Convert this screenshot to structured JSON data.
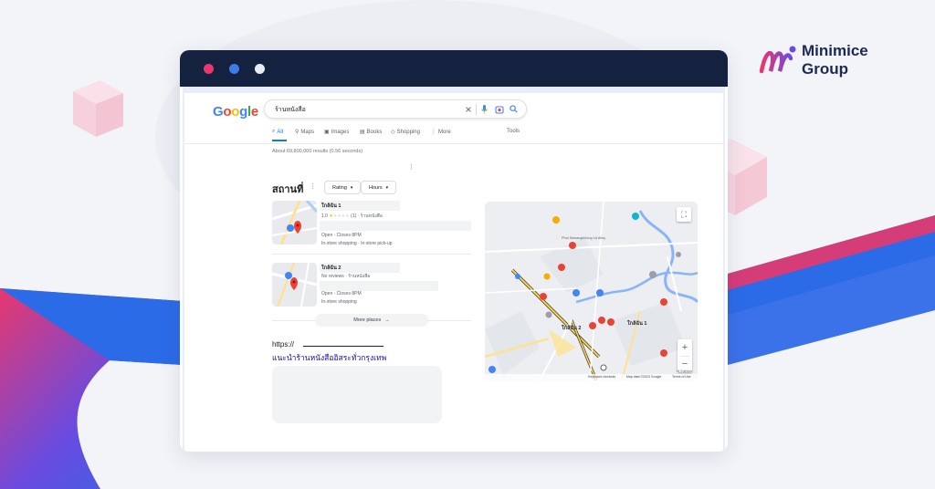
{
  "brand": {
    "name_line1": "Minimice",
    "name_line2": "Group"
  },
  "colors": {
    "titlebar": "#142240",
    "window_dot_red": "#e8386d",
    "window_dot_blue": "#3d7be8",
    "window_dot_white": "#e8ecf5",
    "google_blue": "#4285F4",
    "google_red": "#EA4335",
    "google_yellow": "#FBBC05",
    "google_green": "#34A853",
    "link": "#1a0dab",
    "accent_pink": "#e8386d",
    "accent_blue": "#2c6be8"
  },
  "google": {
    "logo": [
      "G",
      "o",
      "o",
      "g",
      "l",
      "e"
    ],
    "search_query": "ร้านหนังสือ",
    "icons": [
      "clear-icon",
      "mic-icon",
      "camera-icon",
      "search-icon"
    ],
    "tabs": [
      {
        "label": "All",
        "icon": "search-icon"
      },
      {
        "label": "Maps",
        "icon": "pin-icon"
      },
      {
        "label": "Images",
        "icon": "image-icon"
      },
      {
        "label": "Books",
        "icon": "book-icon"
      },
      {
        "label": "Shopping",
        "icon": "tag-icon"
      },
      {
        "label": "More",
        "icon": "more-icon"
      },
      {
        "label": "Tools",
        "icon": ""
      }
    ],
    "results_count": "About 69,800,000 results (0.56 seconds)"
  },
  "places": {
    "title": "สถานที่",
    "filters": [
      "Rating",
      "Hours"
    ],
    "items": [
      {
        "name": "ใกล้ฉัน 1",
        "rating": "1.0",
        "rating_count": "(1)",
        "category": "ร้านหนังสือ",
        "hours": "Open · Closes 8PM",
        "services": "In-store shopping · In-store pick-up"
      },
      {
        "name": "ใกล้ฉัน 2",
        "reviews": "No reviews",
        "category": "ร้านหนังสือ",
        "hours": "Open · Closes 8PM",
        "services": "In-store shopping"
      }
    ],
    "more_label": "More places"
  },
  "result": {
    "url_prefix": "https://",
    "title": "แนะนำร้านหนังสืออิสระทั่วกรุงเทพ"
  },
  "map": {
    "road_label": "Phai Sawangkhlong 1A Alley",
    "pin_label_1": "ใกล้ฉัน 1",
    "pin_label_2": "ใกล้ฉัน 2",
    "footer_shortcuts": "Keyboard shortcuts",
    "footer_data": "Map data ©2023 Google",
    "footer_terms": "Terms of Use",
    "zoom_in": "+",
    "zoom_out": "−",
    "corner_label": "Hi Suthisiri"
  }
}
